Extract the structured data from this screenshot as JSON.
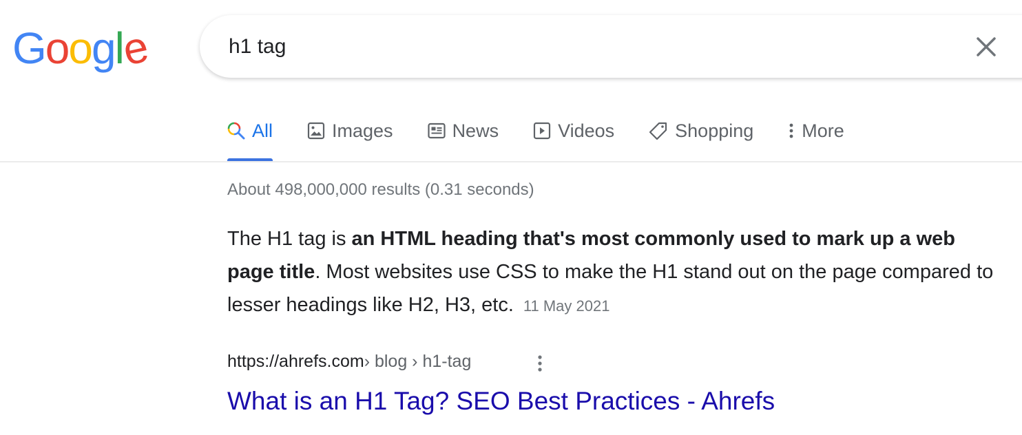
{
  "logo": {
    "letters": [
      {
        "char": "G",
        "color": "#4285f4"
      },
      {
        "char": "o",
        "color": "#ea4335"
      },
      {
        "char": "o",
        "color": "#fbbc05"
      },
      {
        "char": "g",
        "color": "#4285f4"
      },
      {
        "char": "l",
        "color": "#34a853"
      },
      {
        "char": "e",
        "color": "#ea4335"
      }
    ]
  },
  "search": {
    "value": "h1 tag",
    "clear_icon": "close-icon"
  },
  "tabs": [
    {
      "label": "All",
      "icon": "search-icon",
      "active": true
    },
    {
      "label": "Images",
      "icon": "image-icon",
      "active": false
    },
    {
      "label": "News",
      "icon": "news-icon",
      "active": false
    },
    {
      "label": "Videos",
      "icon": "play-icon",
      "active": false
    },
    {
      "label": "Shopping",
      "icon": "tag-icon",
      "active": false
    },
    {
      "label": "More",
      "icon": "more-vert-icon",
      "active": false
    }
  ],
  "stats": "About 498,000,000 results (0.31 seconds)",
  "featured_snippet": {
    "text_before": "The H1 tag is ",
    "bold": "an HTML heading that's most commonly used to mark up a web page title",
    "text_after": ". Most websites use CSS to make the H1 stand out on the page compared to lesser headings like H2, H3, etc.",
    "date": "11 May 2021"
  },
  "result": {
    "url": "https://ahrefs.com",
    "breadcrumb": " › blog › h1-tag",
    "title": "What is an H1 Tag? SEO Best Practices - Ahrefs"
  },
  "colors": {
    "accent": "#1a73e8",
    "link": "#1a0dab",
    "secondary_text": "#70757a"
  }
}
